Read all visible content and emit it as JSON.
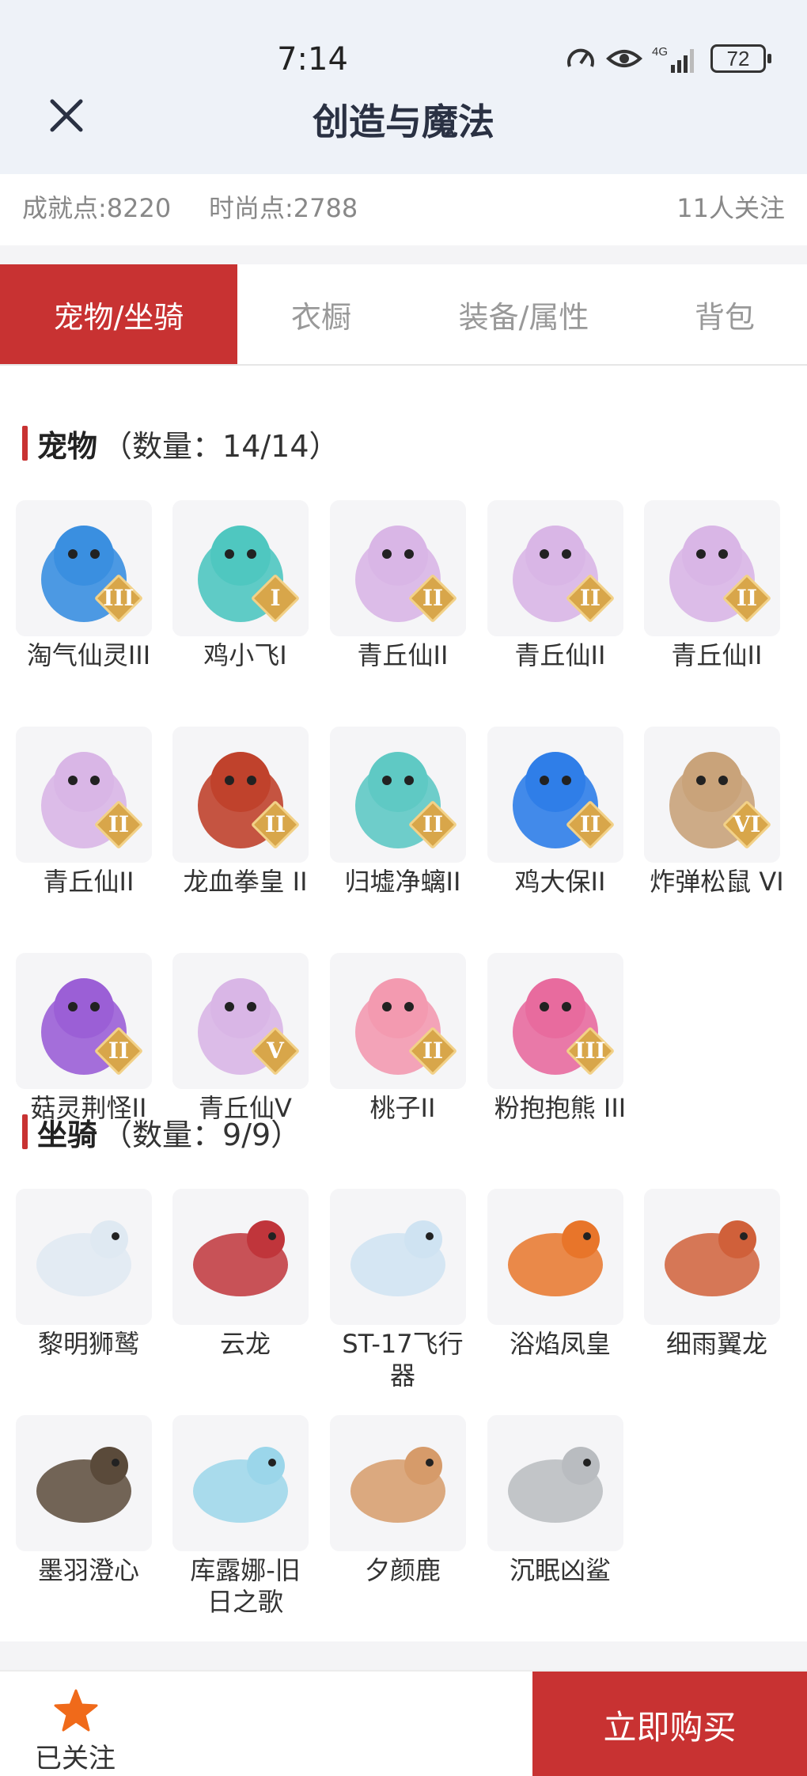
{
  "status_bar": {
    "time": "7:14",
    "network": "4G",
    "battery": "72"
  },
  "header": {
    "title": "创造与魔法",
    "close_icon": "close-icon"
  },
  "role_info": {
    "achievement_label": "成就点:",
    "achievement_value": "8220",
    "fashion_label": "时尚点:",
    "fashion_value": "2788",
    "followers": "11人关注"
  },
  "tabs": [
    {
      "label": "宠物/坐骑",
      "active": true
    },
    {
      "label": "衣橱",
      "active": false
    },
    {
      "label": "装备/属性",
      "active": false
    },
    {
      "label": "背包",
      "active": false
    }
  ],
  "pets_section": {
    "title": "宠物",
    "count": "（数量：14/14）",
    "items": [
      {
        "name": "淘气仙灵III",
        "grade": "III",
        "icon": "blue-puppy-pet-icon",
        "color": "#3a8fe0"
      },
      {
        "name": "鸡小飞I",
        "grade": "I",
        "icon": "teal-chick-pet-icon",
        "color": "#4fc7c0"
      },
      {
        "name": "青丘仙II",
        "grade": "II",
        "icon": "fox-fairy-pet-icon",
        "color": "#d9b6e6"
      },
      {
        "name": "青丘仙II",
        "grade": "II",
        "icon": "fox-fairy-pet-icon",
        "color": "#d9b6e6"
      },
      {
        "name": "青丘仙II",
        "grade": "II",
        "icon": "fox-fairy-pet-icon",
        "color": "#d9b6e6"
      },
      {
        "name": "青丘仙II",
        "grade": "II",
        "icon": "fox-fairy-pet-icon",
        "color": "#d9b6e6"
      },
      {
        "name": "龙血拳皇 II",
        "grade": "II",
        "icon": "red-demon-pet-icon",
        "color": "#c0422c"
      },
      {
        "name": "归墟净螭II",
        "grade": "II",
        "icon": "cyan-dragon-pet-icon",
        "color": "#5fc9c4"
      },
      {
        "name": "鸡大保II",
        "grade": "II",
        "icon": "blue-bird-sunglasses-pet-icon",
        "color": "#2f7ee8"
      },
      {
        "name": "炸弹松鼠 VI",
        "grade": "VI",
        "icon": "squirrel-pet-icon",
        "color": "#c9a37a"
      },
      {
        "name": "菇灵荆怪II",
        "grade": "II",
        "icon": "purple-mushroom-sprite-pet-icon",
        "color": "#9b5fd6"
      },
      {
        "name": "青丘仙V",
        "grade": "V",
        "icon": "fox-fairy-pet-icon",
        "color": "#d9b6e6"
      },
      {
        "name": "桃子II",
        "grade": "II",
        "icon": "pink-cat-pet-icon",
        "color": "#f39ab0"
      },
      {
        "name": "粉抱抱熊 III",
        "grade": "III",
        "icon": "pink-bear-pet-icon",
        "color": "#e86b9e"
      }
    ]
  },
  "mounts_section": {
    "title": "坐骑",
    "count": "（数量：9/9）",
    "items": [
      {
        "name": "黎明狮鹫",
        "icon": "griffin-mount-icon",
        "color": "#dfe9f2"
      },
      {
        "name": "云龙",
        "icon": "red-dragon-mount-icon",
        "color": "#c0353b"
      },
      {
        "name": "ST-17飞行器",
        "icon": "aircraft-mount-icon",
        "color": "#cfe3f2"
      },
      {
        "name": "浴焰凤皇",
        "icon": "phoenix-mount-icon",
        "color": "#e8752a"
      },
      {
        "name": "细雨翼龙",
        "icon": "pterosaur-mount-icon",
        "color": "#d0603a"
      },
      {
        "name": "墨羽澄心",
        "icon": "feather-staff-mount-icon",
        "color": "#5a4a3a"
      },
      {
        "name": "库露娜-旧日之歌",
        "icon": "cloud-girl-mount-icon",
        "color": "#9bd6ea"
      },
      {
        "name": "夕颜鹿",
        "icon": "deer-mount-icon",
        "color": "#d69b6a"
      },
      {
        "name": "沉眠凶鲨",
        "icon": "shark-mount-icon",
        "color": "#b9bcc0"
      }
    ]
  },
  "bottom_bar": {
    "follow_label": "已关注",
    "buy_label": "立即购买"
  },
  "colors": {
    "accent": "#c83232",
    "header_bg": "#eef2f8",
    "grade_badge": "#d8a64a"
  }
}
